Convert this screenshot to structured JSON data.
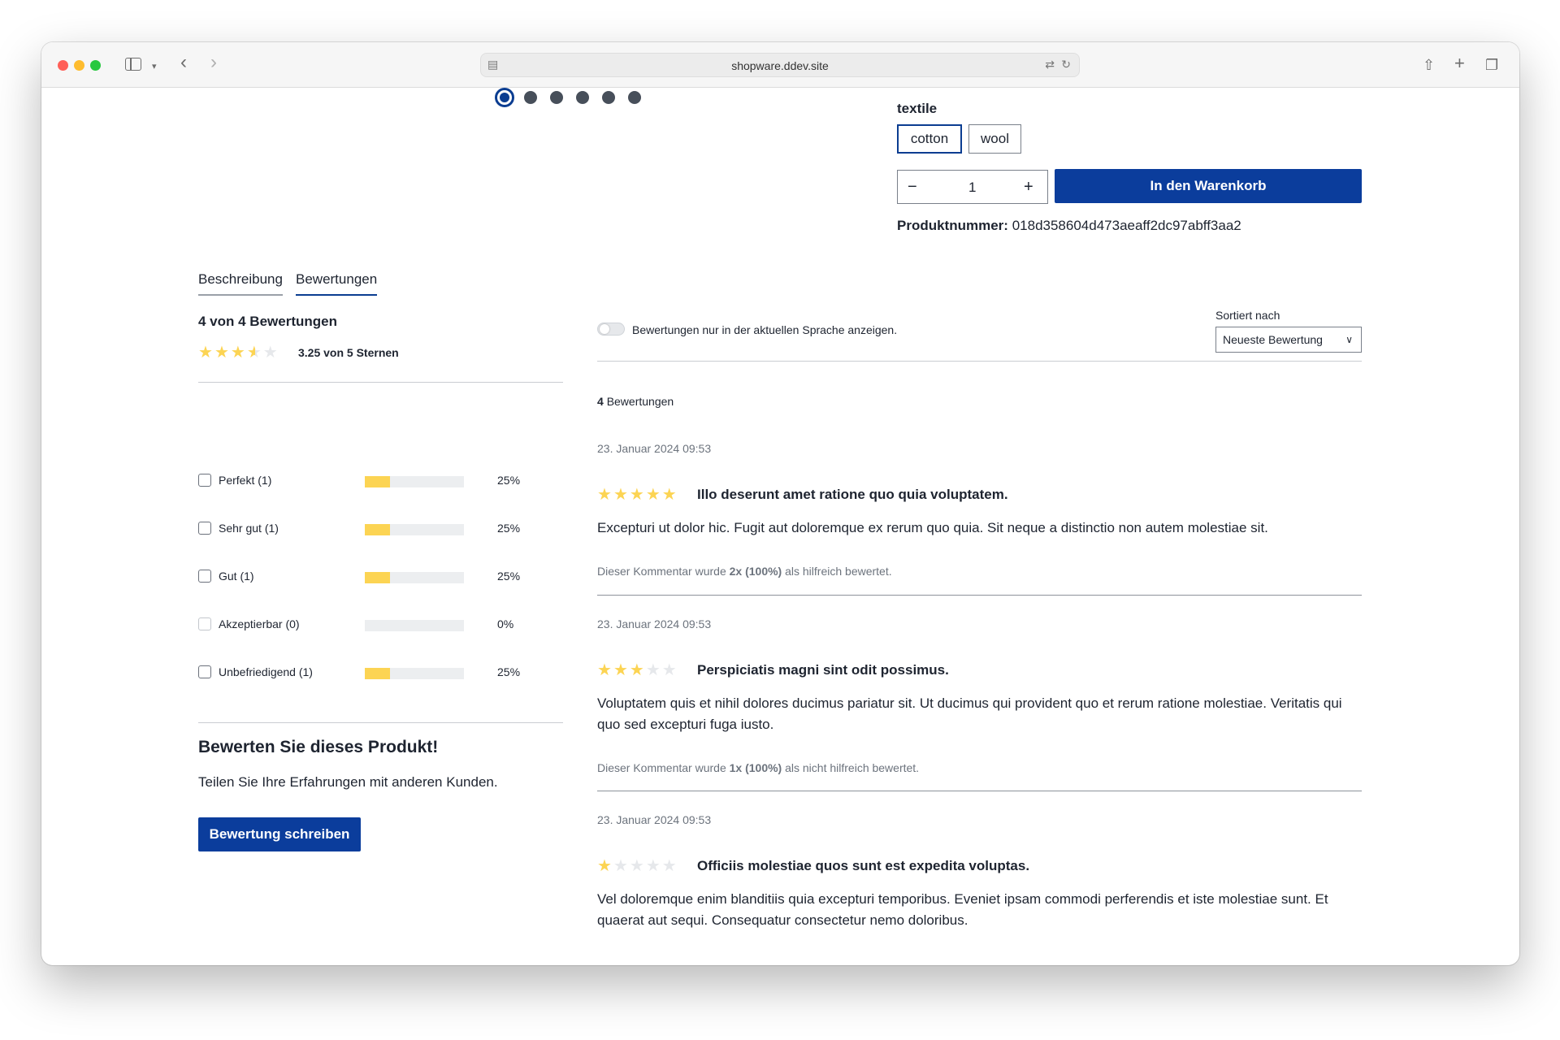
{
  "browser": {
    "url": "shopware.ddev.site"
  },
  "product": {
    "property_label": "textile",
    "options": [
      "cotton",
      "wool"
    ],
    "selected_option": "cotton",
    "quantity": "1",
    "minus_label": "−",
    "plus_label": "+",
    "cart_button": "In den Warenkorb",
    "number_label": "Produktnummer:",
    "number_value": "018d358604d473aeaff2dc97abff3aa2",
    "gallery_dots": 6,
    "gallery_active": 1
  },
  "tabs": {
    "description": "Beschreibung",
    "reviews": "Bewertungen"
  },
  "summary": {
    "title": "4 von 4 Bewertungen",
    "average_rating": 3.25,
    "average_text": "3.25 von 5 Sternen",
    "filters": [
      {
        "label": "Perfekt (1)",
        "fraction": 0.25,
        "percent": "25%",
        "enabled": true
      },
      {
        "label": "Sehr gut (1)",
        "fraction": 0.25,
        "percent": "25%",
        "enabled": true
      },
      {
        "label": "Gut (1)",
        "fraction": 0.25,
        "percent": "25%",
        "enabled": true
      },
      {
        "label": "Akzeptierbar (0)",
        "fraction": 0,
        "percent": "0%",
        "enabled": false
      },
      {
        "label": "Unbefriedigend (1)",
        "fraction": 0.25,
        "percent": "25%",
        "enabled": true
      }
    ]
  },
  "cta": {
    "title": "Bewerten Sie dieses Produkt!",
    "subtitle": "Teilen Sie Ihre Erfahrungen mit anderen Kunden.",
    "button": "Bewertung schreiben"
  },
  "reviews_panel": {
    "toggle_label": "Bewertungen nur in der aktuellen Sprache anzeigen.",
    "sort_label": "Sortiert nach",
    "sort_value": "Neueste Bewertung",
    "count_number": "4",
    "count_label": "Bewertungen"
  },
  "reviews": [
    {
      "date": "23. Januar 2024 09:53",
      "rating": 5,
      "title": "Illo deserunt amet ratione quo quia voluptatem.",
      "text": "Excepturi ut dolor hic. Fugit aut doloremque ex rerum quo quia. Sit neque a distinctio non autem molestiae sit.",
      "help_prefix": "Dieser Kommentar wurde",
      "help_value": "2x (100%)",
      "help_suffix": "als hilfreich bewertet."
    },
    {
      "date": "23. Januar 2024 09:53",
      "rating": 3,
      "title": "Perspiciatis magni sint odit possimus.",
      "text": "Voluptatem quis et nihil dolores ducimus pariatur sit. Ut ducimus qui provident quo et rerum ratione molestiae. Veritatis qui quo sed excepturi fuga iusto.",
      "help_prefix": "Dieser Kommentar wurde",
      "help_value": "1x (100%)",
      "help_suffix": "als nicht hilfreich bewertet."
    },
    {
      "date": "23. Januar 2024 09:53",
      "rating": 1,
      "title": "Officiis molestiae quos sunt est expedita voluptas.",
      "text": "Vel doloremque enim blanditiis quia excepturi temporibus. Eveniet ipsam commodi perferendis et iste molestiae sunt. Et quaerat aut sequi. Consequatur consectetur nemo doloribus.",
      "help_prefix": "",
      "help_value": "",
      "help_suffix": ""
    }
  ],
  "colors": {
    "accent": "#0b3d9c",
    "star": "#fcd453",
    "star_empty": "#e6e8eb"
  },
  "icons": {
    "sidebar": "sidebar-icon",
    "back": "chevron-left-icon",
    "forward": "chevron-right-icon",
    "share": "share-icon",
    "new_tab": "plus-icon",
    "tabs": "tabs-overview-icon",
    "translate": "translate-icon",
    "reload": "reload-icon",
    "page_menu": "page-menu-icon"
  }
}
